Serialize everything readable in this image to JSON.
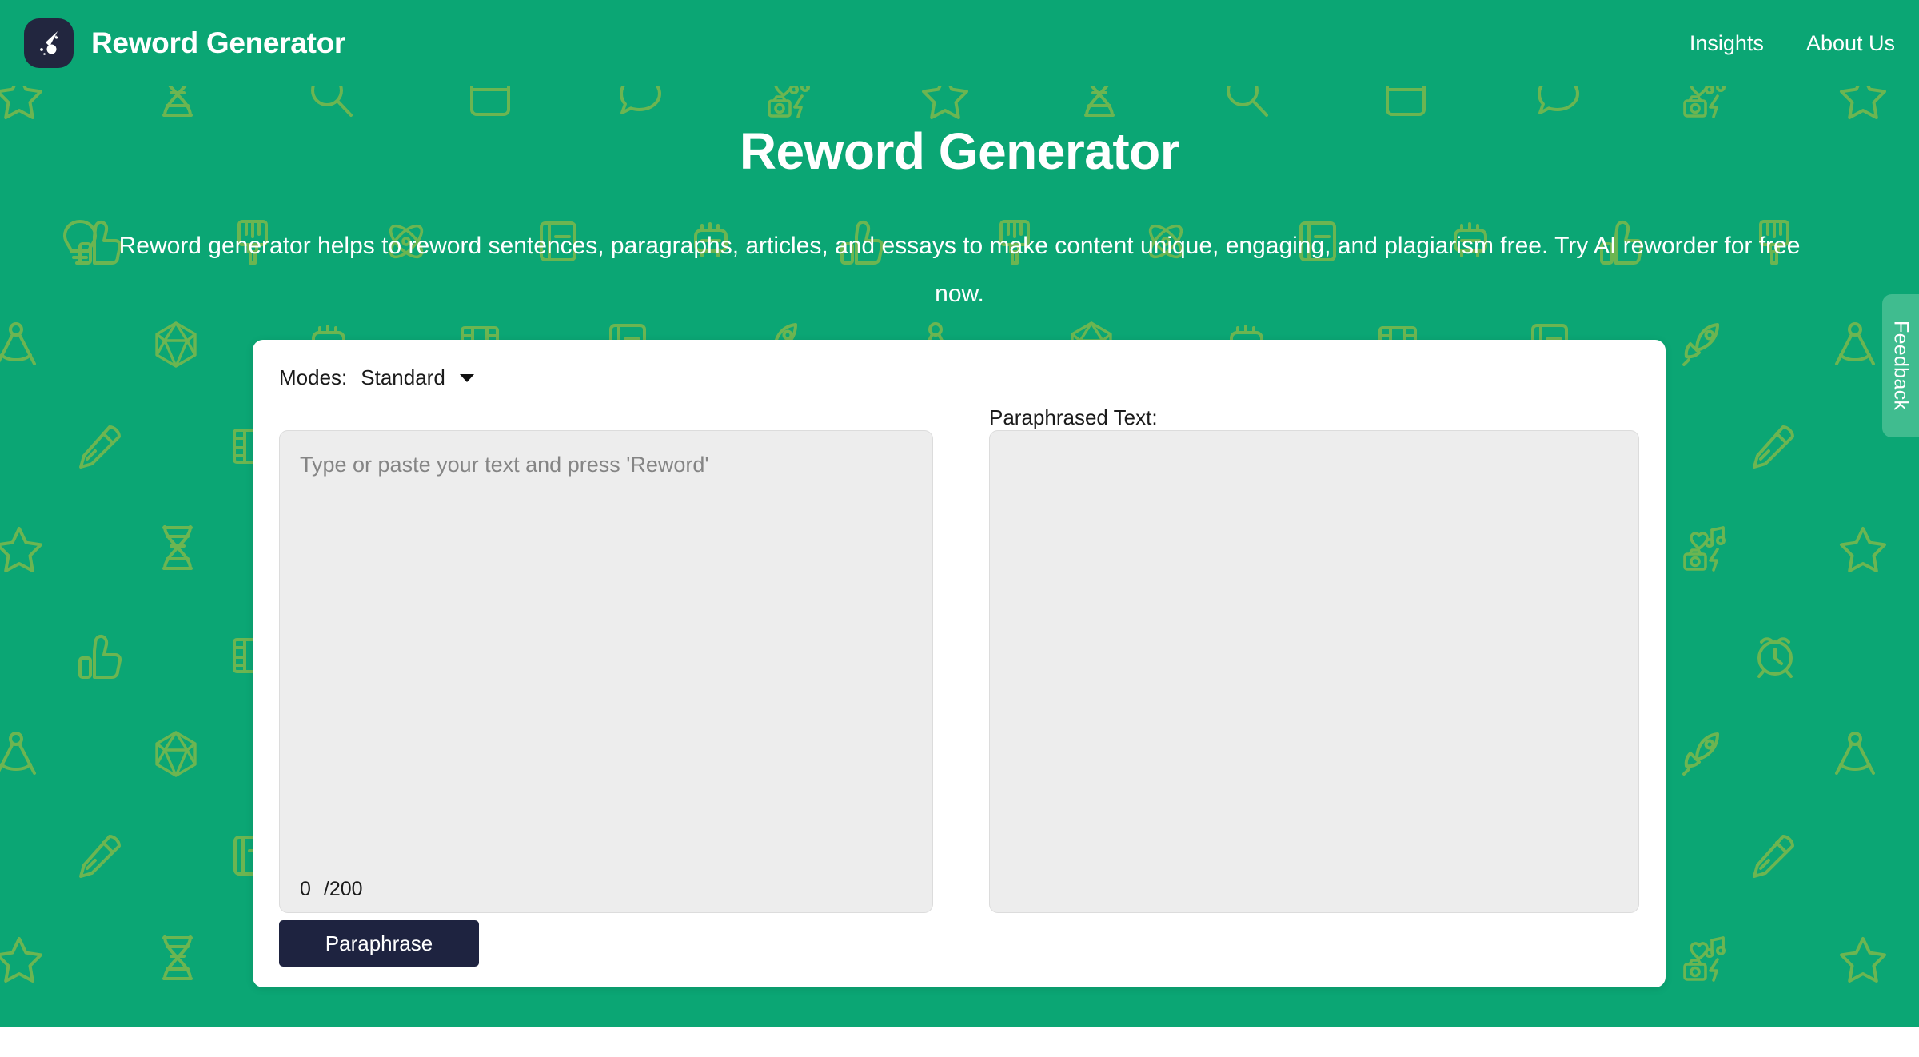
{
  "theme": {
    "brand_green": "#0ba674",
    "pattern_icon_color": "#a8bf3d",
    "logo_navy": "#22263f",
    "button_navy": "#1e2340",
    "field_gray": "#ededed",
    "feedback_green": "#40bc8f"
  },
  "header": {
    "logo_icon": "comet-icon",
    "brand_title": "Reword Generator",
    "nav": [
      {
        "label": "Insights"
      },
      {
        "label": "About Us"
      }
    ]
  },
  "hero": {
    "title": "Reword Generator",
    "subtitle": "Reword generator helps to reword sentences, paragraphs, articles, and essays to make content unique, engaging, and plagiarism free. Try AI reworder for free now."
  },
  "tool": {
    "modes_label": "Modes:",
    "mode_selected": "Standard",
    "mode_options": [
      "Standard"
    ],
    "input_placeholder": "Type or paste your text and press 'Reword'",
    "input_value": "",
    "char_count": "0",
    "char_limit": "/200",
    "output_label": "Paraphrased Text:",
    "output_value": "",
    "submit_label": "Paraphrase"
  },
  "feedback": {
    "label": "Feedback"
  },
  "pattern": {
    "icons": [
      "star-icon",
      "dna-icon",
      "magnifier-icon",
      "calendar-icon",
      "speech-bubble-icon",
      "heart-music-camera-bolt-icon",
      "thumbs-up-icon",
      "paintbrush-icon",
      "atom-icon",
      "book-icon",
      "mouse-icon",
      "compass-icon",
      "d20-dice-icon",
      "pen-icon",
      "film-strip-icon",
      "rocket-icon",
      "alarm-clock-icon",
      "lightbulb-icon"
    ]
  }
}
